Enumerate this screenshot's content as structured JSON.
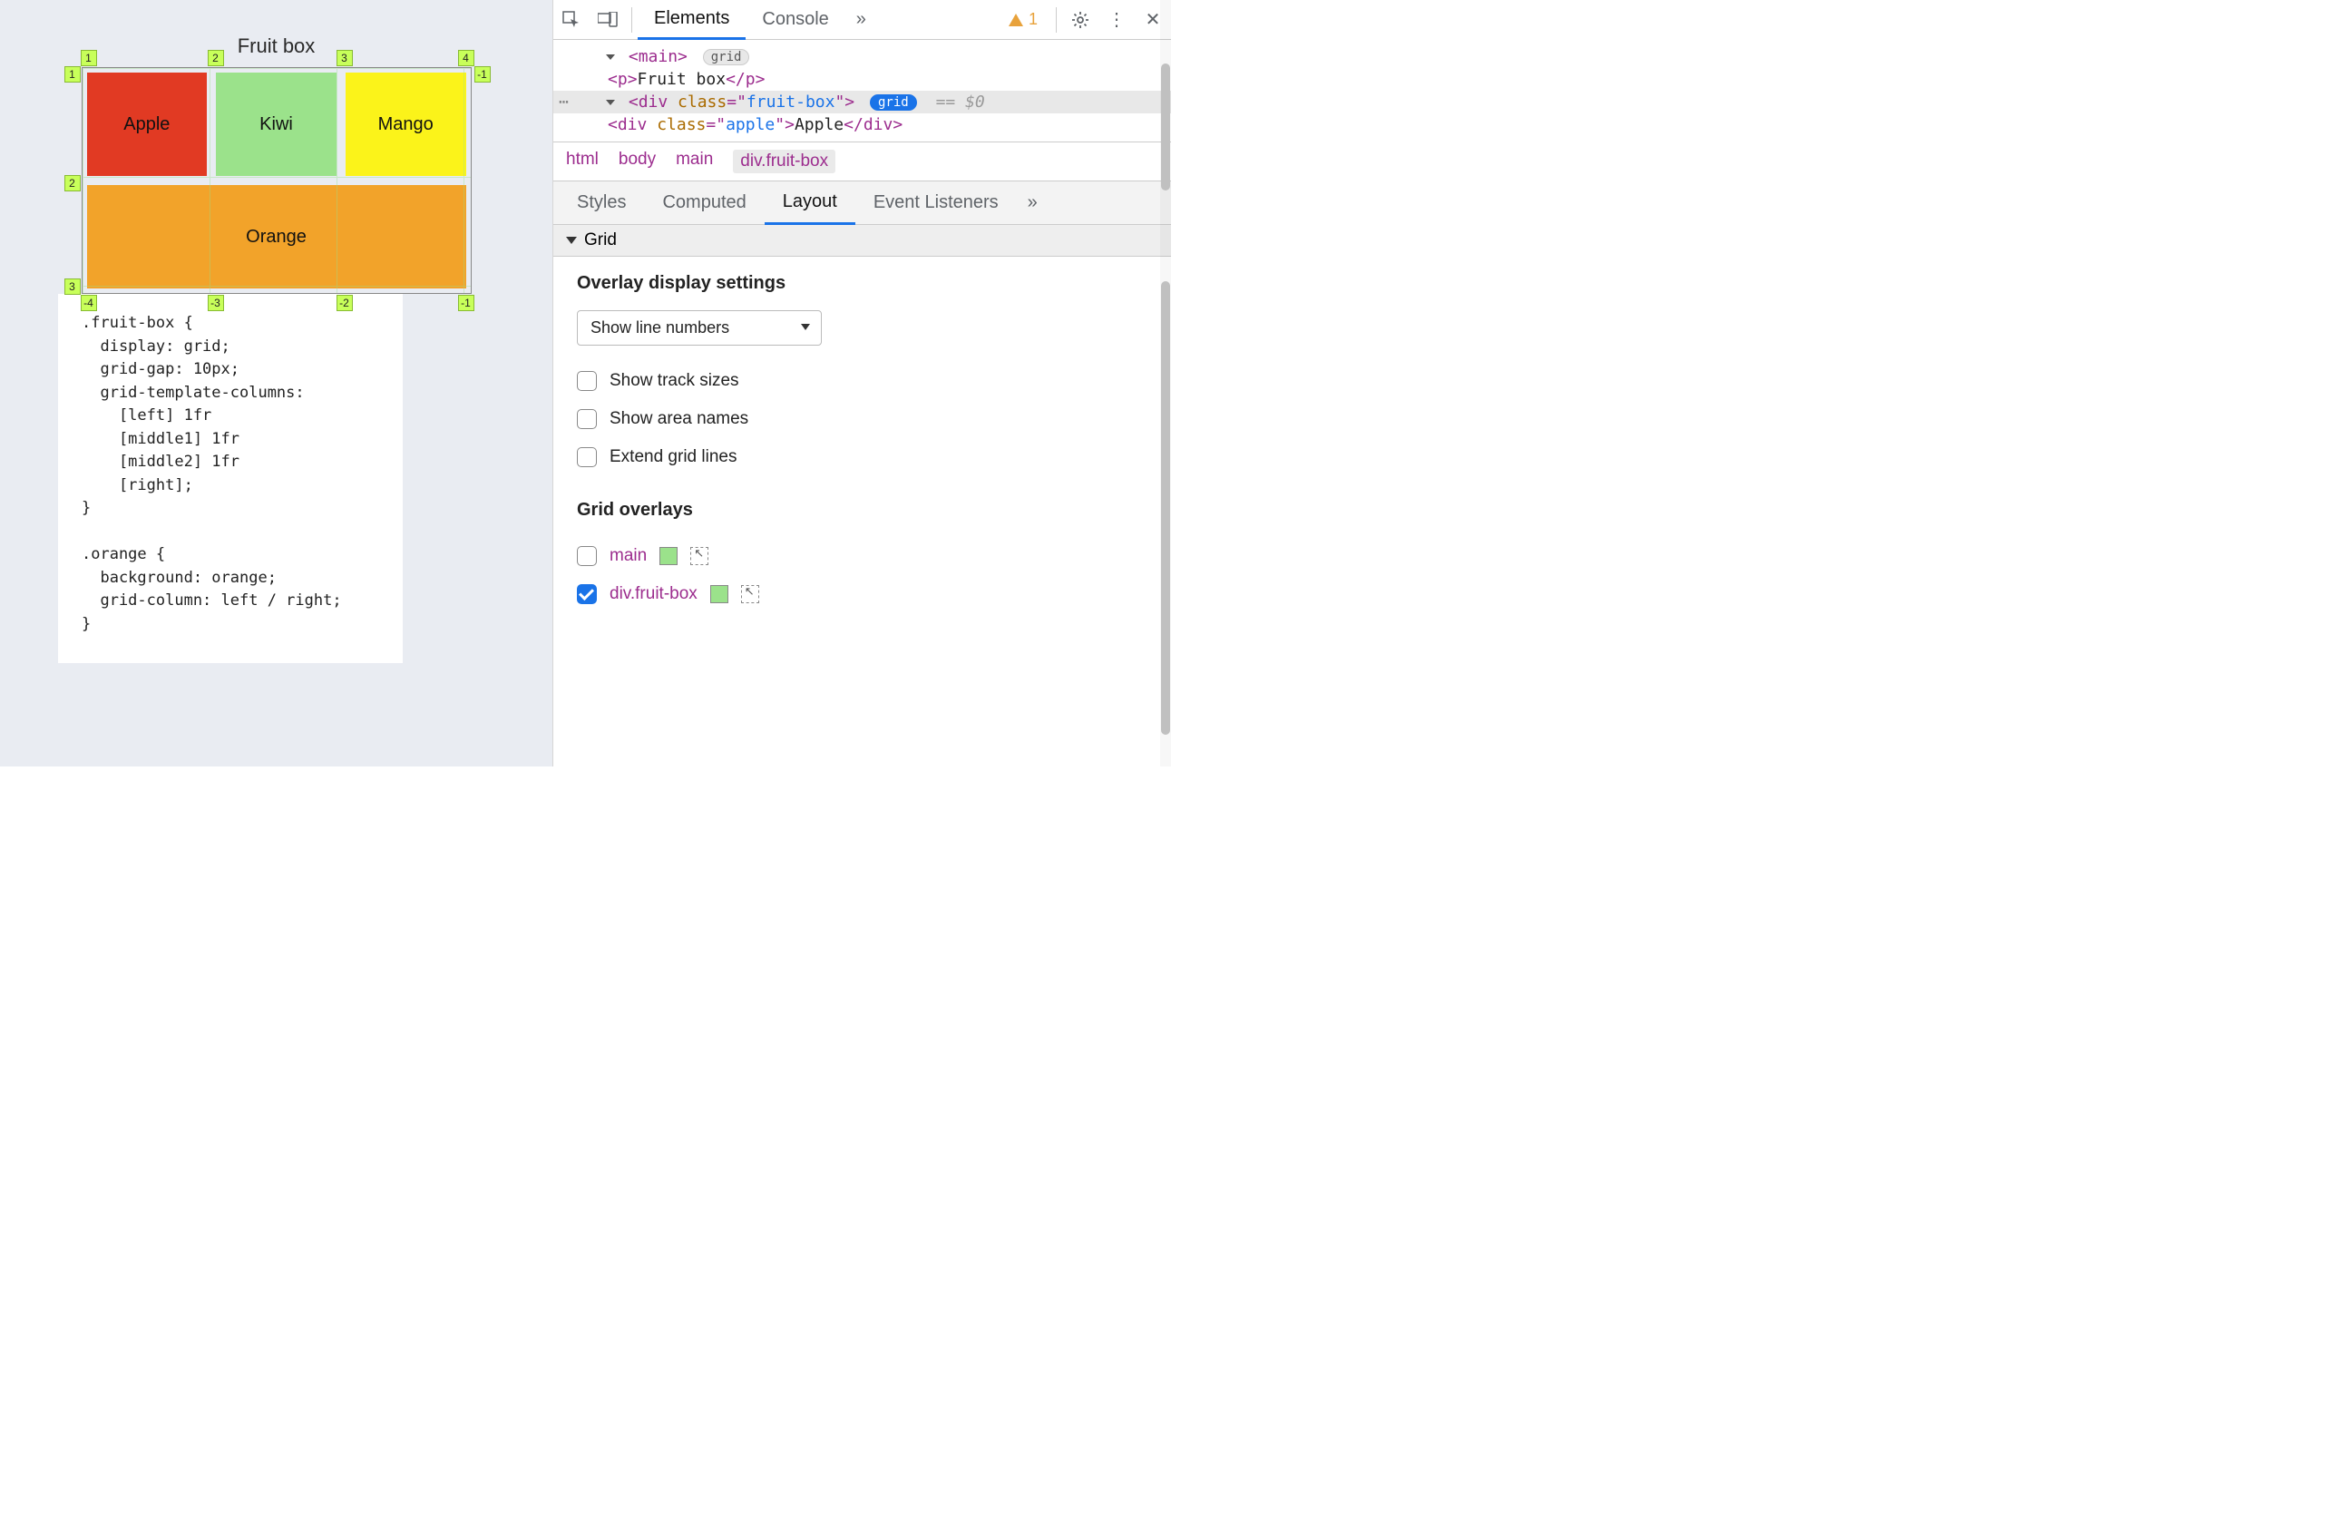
{
  "page": {
    "title": "Fruit box",
    "cells": {
      "apple": "Apple",
      "kiwi": "Kiwi",
      "mango": "Mango",
      "orange": "Orange"
    },
    "grid_line_labels": {
      "top": [
        "1",
        "2",
        "3",
        "4"
      ],
      "left": [
        "1",
        "2",
        "3"
      ],
      "right_top": "-1",
      "bottom": [
        "-4",
        "-3",
        "-2",
        "-1"
      ]
    },
    "css_text": ".fruit-box {\n  display: grid;\n  grid-gap: 10px;\n  grid-template-columns:\n    [left] 1fr\n    [middle1] 1fr\n    [middle2] 1fr\n    [right];\n}\n\n.orange {\n  background: orange;\n  grid-column: left / right;\n}"
  },
  "devtools": {
    "tabs": {
      "elements": "Elements",
      "console": "Console",
      "more": "»"
    },
    "toolbar": {
      "warn_count": "1"
    },
    "dom": {
      "main_tag": "main",
      "main_badge": "grid",
      "p_tag": "p",
      "p_text": "Fruit box",
      "fruitbox_tag": "div",
      "fruitbox_class_attr": "class",
      "fruitbox_class_val": "fruit-box",
      "fruitbox_badge": "grid",
      "eq": "== $0",
      "apple_tag": "div",
      "apple_class_attr": "class",
      "apple_class_val": "apple",
      "apple_text": "Apple"
    },
    "crumb": [
      "html",
      "body",
      "main",
      "div.fruit-box"
    ],
    "subtabs": {
      "styles": "Styles",
      "computed": "Computed",
      "layout": "Layout",
      "listeners": "Event Listeners",
      "more": "»"
    },
    "grid_section": {
      "title": "Grid",
      "overlay_settings_title": "Overlay display settings",
      "select_value": "Show line numbers",
      "checkboxes": {
        "track_sizes": "Show track sizes",
        "area_names": "Show area names",
        "extend_lines": "Extend grid lines"
      },
      "overlays_title": "Grid overlays",
      "overlays": [
        {
          "label": "main",
          "checked": false,
          "swatch": "#9be28b"
        },
        {
          "label": "div.fruit-box",
          "checked": true,
          "swatch": "#9be28b"
        }
      ]
    }
  }
}
